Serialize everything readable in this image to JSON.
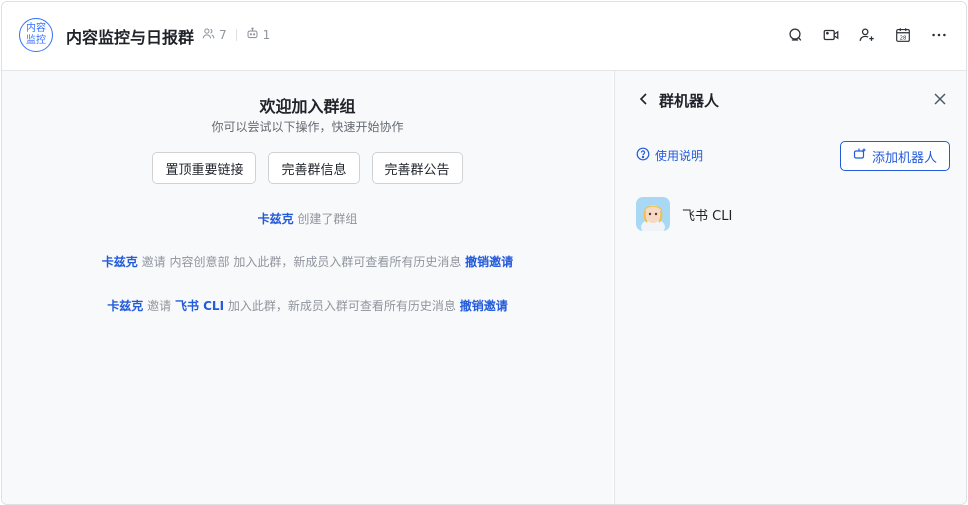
{
  "header": {
    "avatar_text": "内容监控",
    "title": "内容监控与日报群",
    "member_count": "7",
    "bot_count": "1",
    "toolbar_icons": [
      "search-chat-icon",
      "video-icon",
      "add-member-icon",
      "calendar-icon",
      "more-icon"
    ],
    "calendar_day": "28"
  },
  "chat": {
    "welcome_title": "欢迎加入群组",
    "welcome_sub": "你可以尝试以下操作，快速开始协作",
    "actions": [
      "置顶重要链接",
      "完善群信息",
      "完善群公告"
    ],
    "system_messages": [
      {
        "actor": "卡兹克",
        "text": "创建了群组"
      },
      {
        "actor": "卡兹克",
        "mid1": "邀请",
        "target": "内容创意部",
        "tail": "加入此群，新成员入群可查看所有历史消息",
        "action": "撤销邀请"
      },
      {
        "actor": "卡兹克",
        "mid1": "邀请",
        "target": "飞书 CLI",
        "tail": "加入此群，新成员入群可查看所有历史消息",
        "action": "撤销邀请"
      }
    ]
  },
  "panel": {
    "title": "群机器人",
    "help_label": "使用说明",
    "add_label": "添加机器人",
    "bots": [
      {
        "name": "飞书 CLI"
      }
    ]
  },
  "colors": {
    "accent": "#245bdb",
    "brand": "#3370ff",
    "muted": "#8f959e",
    "panel_bg": "#f8f9fa"
  }
}
